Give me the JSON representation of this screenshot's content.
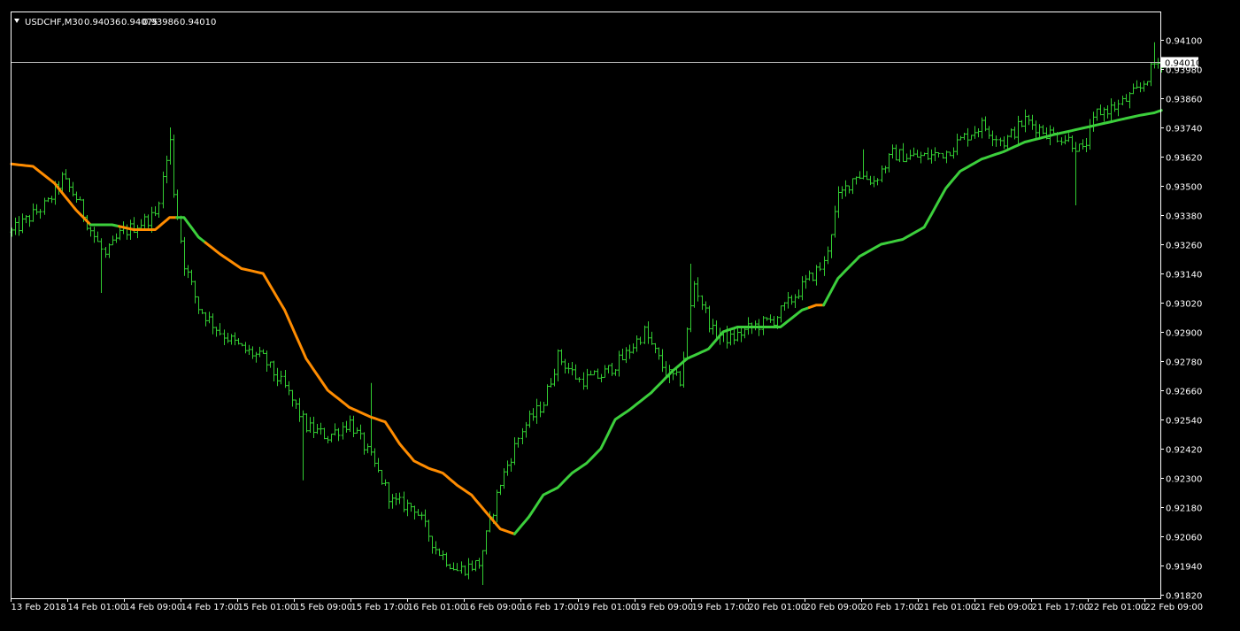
{
  "header": {
    "symbol_timeframe": "USDCHF,M30",
    "open": "0.94036",
    "high": "0.94075",
    "low": "0.93986",
    "close": "0.94010",
    "dropdown_icon": "triangle-down-icon"
  },
  "colors": {
    "background": "#000000",
    "frame": "#ffffff",
    "bars": "#32cd32",
    "ma_up": "#3ccf3c",
    "ma_down": "#ff8c00",
    "price_line": "#c0c0c0",
    "text": "#ffffff",
    "price_box_bg": "#ffffff",
    "price_box_text": "#000000"
  },
  "chart_data": {
    "type": "line",
    "title": "USDCHF,M30",
    "timeframe": "M30",
    "current_price": "0.94010",
    "ylim": [
      0.9182,
      0.941
    ],
    "y_ticks": [
      "0.94100",
      "0.93980",
      "0.93860",
      "0.93740",
      "0.93620",
      "0.93500",
      "0.93380",
      "0.93260",
      "0.93140",
      "0.93020",
      "0.92900",
      "0.92780",
      "0.92660",
      "0.92540",
      "0.92420",
      "0.92300",
      "0.92180",
      "0.92060",
      "0.91940",
      "0.91820"
    ],
    "x_ticks": [
      "13 Feb 2018",
      "14 Feb 01:00",
      "14 Feb 09:00",
      "14 Feb 17:00",
      "15 Feb 01:00",
      "15 Feb 09:00",
      "15 Feb 17:00",
      "16 Feb 01:00",
      "16 Feb 09:00",
      "16 Feb 17:00",
      "19 Feb 01:00",
      "19 Feb 09:00",
      "19 Feb 17:00",
      "20 Feb 01:00",
      "20 Feb 09:00",
      "20 Feb 17:00",
      "21 Feb 01:00",
      "21 Feb 09:00",
      "21 Feb 17:00",
      "22 Feb 01:00",
      "22 Feb 09:00"
    ],
    "grid": false,
    "legend": "none",
    "close_anchors": [
      [
        0,
        0.9331
      ],
      [
        10,
        0.9343
      ],
      [
        14,
        0.9353
      ],
      [
        18,
        0.9345
      ],
      [
        22,
        0.9332
      ],
      [
        26,
        0.9321
      ],
      [
        30,
        0.933
      ],
      [
        35,
        0.9334
      ],
      [
        40,
        0.9338
      ],
      [
        44,
        0.9368
      ],
      [
        45,
        0.9348
      ],
      [
        48,
        0.9318
      ],
      [
        52,
        0.93
      ],
      [
        58,
        0.929
      ],
      [
        64,
        0.9283
      ],
      [
        70,
        0.9279
      ],
      [
        76,
        0.9267
      ],
      [
        82,
        0.9251
      ],
      [
        88,
        0.9247
      ],
      [
        94,
        0.9253
      ],
      [
        100,
        0.9238
      ],
      [
        106,
        0.922
      ],
      [
        112,
        0.9218
      ],
      [
        118,
        0.9201
      ],
      [
        124,
        0.9192
      ],
      [
        130,
        0.9195
      ],
      [
        136,
        0.9228
      ],
      [
        142,
        0.925
      ],
      [
        148,
        0.9261
      ],
      [
        152,
        0.928
      ],
      [
        158,
        0.927
      ],
      [
        164,
        0.9272
      ],
      [
        170,
        0.9279
      ],
      [
        176,
        0.929
      ],
      [
        182,
        0.9273
      ],
      [
        186,
        0.927
      ],
      [
        190,
        0.931
      ],
      [
        195,
        0.929
      ],
      [
        200,
        0.9287
      ],
      [
        206,
        0.9292
      ],
      [
        212,
        0.9295
      ],
      [
        218,
        0.9305
      ],
      [
        222,
        0.9312
      ],
      [
        226,
        0.9318
      ],
      [
        230,
        0.9345
      ],
      [
        235,
        0.9355
      ],
      [
        240,
        0.9352
      ],
      [
        245,
        0.9363
      ],
      [
        250,
        0.9362
      ],
      [
        255,
        0.9362
      ],
      [
        260,
        0.9364
      ],
      [
        265,
        0.937
      ],
      [
        270,
        0.9375
      ],
      [
        276,
        0.9368
      ],
      [
        282,
        0.9377
      ],
      [
        288,
        0.9372
      ],
      [
        294,
        0.9369
      ],
      [
        298,
        0.9364
      ],
      [
        302,
        0.938
      ],
      [
        308,
        0.9383
      ],
      [
        314,
        0.939
      ],
      [
        318,
        0.94
      ],
      [
        320,
        0.9401
      ]
    ],
    "ma_anchors": [
      [
        0,
        0.9359
      ],
      [
        6,
        0.9358
      ],
      [
        12,
        0.9351
      ],
      [
        18,
        0.934
      ],
      [
        22,
        0.9334
      ],
      [
        28,
        0.9334
      ],
      [
        34,
        0.9332
      ],
      [
        40,
        0.9332
      ],
      [
        44,
        0.9337
      ],
      [
        48,
        0.9337
      ],
      [
        52,
        0.9329
      ],
      [
        58,
        0.9322
      ],
      [
        64,
        0.9316
      ],
      [
        70,
        0.9314
      ],
      [
        76,
        0.9299
      ],
      [
        82,
        0.9279
      ],
      [
        88,
        0.9266
      ],
      [
        94,
        0.9259
      ],
      [
        100,
        0.9255
      ],
      [
        104,
        0.9253
      ],
      [
        108,
        0.9244
      ],
      [
        112,
        0.9237
      ],
      [
        116,
        0.9234
      ],
      [
        120,
        0.9232
      ],
      [
        124,
        0.9227
      ],
      [
        128,
        0.9223
      ],
      [
        132,
        0.9216
      ],
      [
        136,
        0.9209
      ],
      [
        140,
        0.9207
      ],
      [
        144,
        0.9214
      ],
      [
        148,
        0.9223
      ],
      [
        152,
        0.9226
      ],
      [
        156,
        0.9232
      ],
      [
        160,
        0.9236
      ],
      [
        164,
        0.9242
      ],
      [
        168,
        0.9254
      ],
      [
        172,
        0.9258
      ],
      [
        178,
        0.9265
      ],
      [
        184,
        0.9274
      ],
      [
        188,
        0.9279
      ],
      [
        194,
        0.9283
      ],
      [
        198,
        0.929
      ],
      [
        202,
        0.9292
      ],
      [
        208,
        0.9292
      ],
      [
        214,
        0.9292
      ],
      [
        220,
        0.9299
      ],
      [
        224,
        0.9301
      ],
      [
        226,
        0.9301
      ],
      [
        230,
        0.9312
      ],
      [
        236,
        0.9321
      ],
      [
        242,
        0.9326
      ],
      [
        248,
        0.9328
      ],
      [
        254,
        0.9333
      ],
      [
        260,
        0.9349
      ],
      [
        264,
        0.9356
      ],
      [
        270,
        0.9361
      ],
      [
        276,
        0.9364
      ],
      [
        282,
        0.9368
      ],
      [
        290,
        0.9371
      ],
      [
        296,
        0.9373
      ],
      [
        302,
        0.9375
      ],
      [
        308,
        0.9377
      ],
      [
        314,
        0.9379
      ],
      [
        318,
        0.938
      ],
      [
        320,
        0.9381
      ]
    ],
    "ma_segments": [
      {
        "color": "down",
        "from": 0,
        "to": 22
      },
      {
        "color": "up",
        "from": 22,
        "to": 30
      },
      {
        "color": "down",
        "from": 30,
        "to": 46
      },
      {
        "color": "up",
        "from": 46,
        "to": 54
      },
      {
        "color": "down",
        "from": 54,
        "to": 140
      },
      {
        "color": "up",
        "from": 140,
        "to": 222
      },
      {
        "color": "down",
        "from": 222,
        "to": 226
      },
      {
        "color": "up",
        "from": 226,
        "to": 320
      }
    ],
    "spikes": [
      {
        "bar": 25,
        "low": 0.9306
      },
      {
        "bar": 44,
        "high": 0.9374
      },
      {
        "bar": 81,
        "low": 0.9229
      },
      {
        "bar": 100,
        "high": 0.9269
      },
      {
        "bar": 131,
        "low": 0.9186
      },
      {
        "bar": 189,
        "high": 0.9318
      },
      {
        "bar": 237,
        "high": 0.9365
      },
      {
        "bar": 296,
        "low": 0.9342
      },
      {
        "bar": 318,
        "high": 0.9409
      }
    ]
  }
}
